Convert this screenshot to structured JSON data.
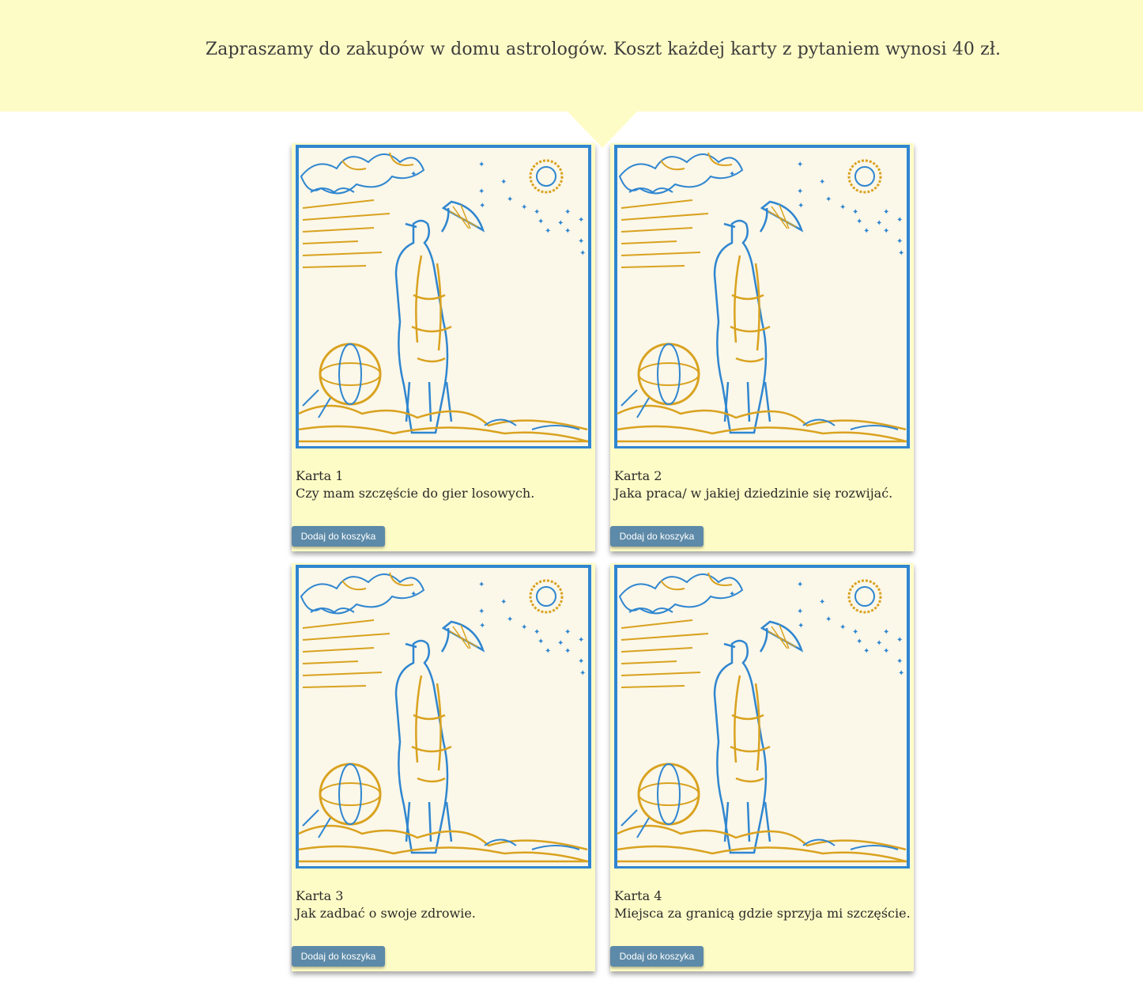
{
  "banner": {
    "text": "Zapraszamy do zakupów w domu astrologów. Koszt każdej karty z pytaniem wynosi 40 zł."
  },
  "cards": [
    {
      "title": "Karta 1",
      "question": "Czy mam szczęście do gier losowych.",
      "button": "Dodaj do koszyka"
    },
    {
      "title": "Karta 2",
      "question": "Jaka praca/ w jakiej dziedzinie się rozwijać.",
      "button": "Dodaj do koszyka"
    },
    {
      "title": "Karta 3",
      "question": "Jak zadbać o swoje zdrowie.",
      "button": "Dodaj do koszyka"
    },
    {
      "title": "Karta 4",
      "question": "Miejsca za granicą gdzie sprzyja mi szczęście.",
      "button": "Dodaj do koszyka"
    }
  ],
  "colors": {
    "banner_bg": "#fefcc6",
    "button_bg": "#5d8aa8",
    "engraving_blue": "#2f86d0",
    "engraving_gold": "#d9a21f"
  }
}
